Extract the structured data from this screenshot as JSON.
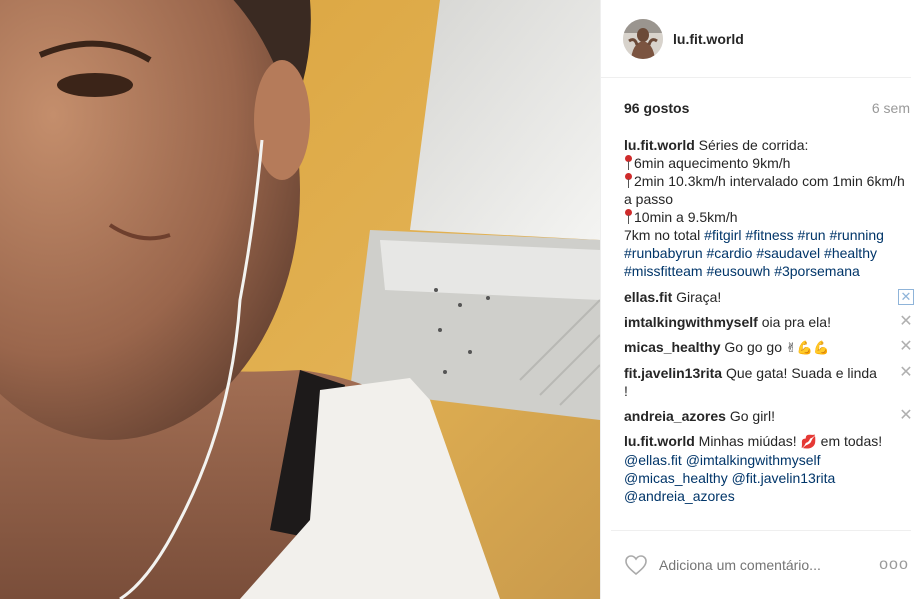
{
  "post": {
    "username": "lu.fit.world",
    "likes": "96 gostos",
    "time": "6 sem",
    "caption": {
      "username": "lu.fit.world",
      "line1": "Séries de corrida:",
      "line2": "6min aquecimento 9km/h",
      "line3": "2min 10.3km/h intervalado com 1min 6km/h a passo",
      "line4": "10min a 9.5km/h",
      "line5": "7km no total",
      "hashtags": [
        "#fitgirl",
        "#fitness",
        "#run",
        "#running",
        "#runbabyrun",
        "#cardio",
        "#saudavel",
        "#healthy",
        "#missfitteam",
        "#eusouwh",
        "#3porsemana"
      ]
    },
    "comments": [
      {
        "username": "ellas.fit",
        "text": "Giraça!"
      },
      {
        "username": "imtalkingwithmyself",
        "text": "oia pra ela!"
      },
      {
        "username": "micas_healthy",
        "text": "Go go go"
      },
      {
        "username": "fit.javelin13rita",
        "text": "Que gata! Suada e linda !"
      },
      {
        "username": "andreia_azores",
        "text": "Go girl!"
      },
      {
        "username": "lu.fit.world",
        "text": "Minhas miúdas!",
        "text2": "em todas!",
        "mentions": [
          "@ellas.fit",
          "@imtalkingwithmyself",
          "@micas_healthy",
          "@fit.javelin13rita",
          "@andreia_azores"
        ]
      }
    ],
    "comment_placeholder": "Adiciona um comentário...",
    "more_label": "ooo"
  },
  "colors": {
    "link": "#003569",
    "muted": "#999999",
    "border": "#efefef"
  },
  "icons": [
    "heart-icon",
    "close-icon",
    "more-options-icon",
    "pushpin-emoji",
    "victory-hand-emoji",
    "flexed-biceps-emoji",
    "kiss-mark-emoji"
  ]
}
